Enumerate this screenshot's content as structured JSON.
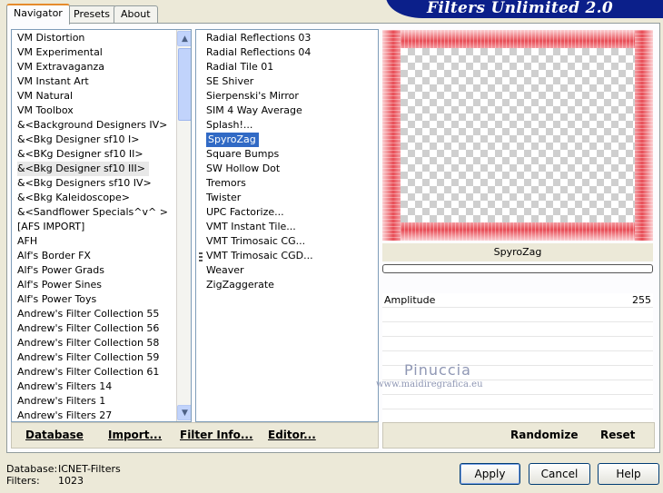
{
  "banner_title": "Filters Unlimited 2.0",
  "tabs": [
    {
      "label": "Navigator",
      "active": true
    },
    {
      "label": "Presets",
      "active": false
    },
    {
      "label": "About",
      "active": false
    }
  ],
  "categories": [
    "VM Distortion",
    "VM Experimental",
    "VM Extravaganza",
    "VM Instant Art",
    "VM Natural",
    "VM Toolbox",
    "&<Background Designers IV>",
    "&<Bkg Designer sf10 I>",
    "&<BKg Designer sf10 II>",
    "&<Bkg Designer sf10 III>",
    "&<Bkg Designers sf10 IV>",
    "&<Bkg Kaleidoscope>",
    "&<Sandflower Specials^v^ >",
    "[AFS IMPORT]",
    "AFH",
    "Alf's Border FX",
    "Alf's Power Grads",
    "Alf's Power Sines",
    "Alf's Power Toys",
    "Andrew's Filter Collection 55",
    "Andrew's Filter Collection 56",
    "Andrew's Filter Collection 58",
    "Andrew's Filter Collection 59",
    "Andrew's Filter Collection 61",
    "Andrew's Filters 14",
    "Andrew's Filters 1",
    "Andrew's Filters 27"
  ],
  "selected_category": "&<Bkg Designer sf10 III>",
  "filters": [
    "Radial Reflections 03",
    "Radial Reflections 04",
    "Radial Tile 01",
    "SE Shiver",
    "Sierpenski's Mirror",
    "SIM 4 Way Average",
    "Splash!...",
    "SpyroZag",
    "Square Bumps",
    "SW Hollow Dot",
    "Tremors",
    "Twister",
    "UPC Factorize...",
    "VMT Instant Tile...",
    "VMT Trimosaic CG...",
    "VMT Trimosaic CGD...",
    "Weaver",
    "ZigZaggerate"
  ],
  "selected_filter": "SpyroZag",
  "left_buttons": [
    "Database",
    "Import...",
    "Filter Info...",
    "Editor..."
  ],
  "filter_name": "SpyroZag",
  "params": [
    {
      "label": "Amplitude",
      "value": "255"
    }
  ],
  "right_buttons": [
    "Randomize",
    "Reset"
  ],
  "watermark": {
    "name": "Pinuccia",
    "url": "www.maidiregrafica.eu"
  },
  "status": {
    "database_label": "Database:",
    "database_value": "ICNET-Filters",
    "filters_label": "Filters:",
    "filters_value": "1023"
  },
  "dialog_buttons": {
    "apply": "Apply",
    "cancel": "Cancel",
    "help": "Help"
  },
  "colors": {
    "banner": "#0b1f8a",
    "selection": "#316ac5",
    "preview_frame": "#e84c55"
  }
}
